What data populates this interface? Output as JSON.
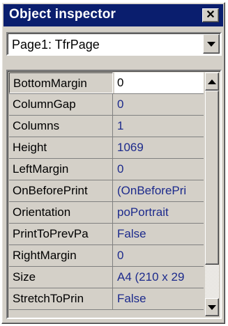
{
  "window": {
    "title": "Object inspector",
    "close_glyph": "✕"
  },
  "object_selector": {
    "selected": "Page1: TfrPage",
    "options": [
      "Page1: TfrPage"
    ]
  },
  "properties": [
    {
      "name": "BottomMargin",
      "value": "0",
      "selected": true
    },
    {
      "name": "ColumnGap",
      "value": "0"
    },
    {
      "name": "Columns",
      "value": "1"
    },
    {
      "name": "Height",
      "value": "1069"
    },
    {
      "name": "LeftMargin",
      "value": "0"
    },
    {
      "name": "OnBeforePrint",
      "value": "(OnBeforePri"
    },
    {
      "name": "Orientation",
      "value": "poPortrait"
    },
    {
      "name": "PrintToPrevPa",
      "value": "False"
    },
    {
      "name": "RightMargin",
      "value": "0"
    },
    {
      "name": "Size",
      "value": "A4 (210 x 29"
    },
    {
      "name": "StretchToPrin",
      "value": "False"
    }
  ],
  "colors": {
    "titlebar": "#0a1e6e",
    "value_text": "#1c2a8c",
    "face": "#d4d0c8"
  },
  "icons": {
    "close": "close-icon",
    "dropdown": "chevron-down-icon",
    "scroll_up": "scroll-up-arrow-icon",
    "scroll_down": "scroll-down-arrow-icon"
  }
}
